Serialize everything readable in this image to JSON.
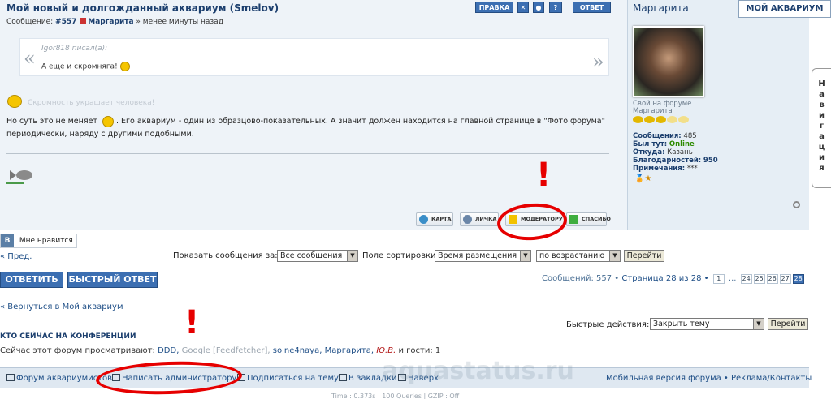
{
  "post": {
    "title": "Мой новый и долгожданный аквариум (Smelov)",
    "meta_prefix": "Сообщение:",
    "post_number": "#557",
    "author": "Маргарита",
    "meta_time": "» менее минуты назад",
    "buttons": {
      "edit": "ПРАВКА",
      "reply": "ОТВЕТ"
    },
    "quote": {
      "author": "Igor818 писал(а):",
      "text": "А еще и скромняга!"
    },
    "motto": "Скромность украшает человека!",
    "body_line1_a": "Но суть это не меняет",
    "body_line1_b": ". Его аквариум - один из образцово-показательных. А значит должен находится на главной странице в \"Фото форума\"",
    "body_line2": "периодически, наряду с другими подобными.",
    "actions": {
      "map": "КАРТА",
      "pm": "ЛИЧКА",
      "moderator": "МОДЕРАТОРУ",
      "thanks": "СПАСИБО"
    }
  },
  "profile": {
    "username": "Маргарита",
    "logo": "МОЙ АКВАРИУМ",
    "role_line1": "Свой на форуме",
    "role_line2": "Маргарита",
    "posts_label": "Сообщения:",
    "posts_value": "485",
    "was_label": "Был тут:",
    "was_value": "Online",
    "from_label": "Откуда:",
    "from_value": "Казань",
    "thanks_label": "Благодарностей:",
    "thanks_value": "950",
    "notes_label": "Примечания:",
    "notes_value": "***"
  },
  "nav_tab": {
    "letters": [
      "Н",
      "а",
      "в",
      "и",
      "г",
      "а",
      "ц",
      "и",
      "я"
    ]
  },
  "like": {
    "vk": "В",
    "label": "Мне нравится"
  },
  "filters": {
    "prev": "« Пред.",
    "show_label": "Показать сообщения за:",
    "show_value": "Все сообщения",
    "sort_label": "Поле сортировки",
    "sort_value": "Время размещения",
    "order_value": "по возрастанию",
    "go": "Перейти"
  },
  "buttons": {
    "reply": "ОТВЕТИТЬ",
    "quick_reply": "БЫСТРЫЙ ОТВЕТ"
  },
  "pagination": {
    "summary_prefix": "Сообщений: 557 •",
    "page_text": "Страница 28 из 28 •",
    "pages": [
      "1",
      "...",
      "24",
      "25",
      "26",
      "27",
      "28"
    ],
    "current": "28"
  },
  "back_link": "« Вернуться в Мой аквариум",
  "quick_actions": {
    "label": "Быстрые действия:",
    "value": "Закрыть тему",
    "go": "Перейти"
  },
  "online": {
    "heading": "КТО СЕЙЧАС НА КОНФЕРЕНЦИИ",
    "prefix": "Сейчас этот форум просматривают:",
    "users": [
      "DDD,",
      "Google [Feedfetcher],",
      "solne4naya,",
      "Маргарита,"
    ],
    "special_user": "Ю.В.",
    "guests": "и гости: 1"
  },
  "footer": {
    "forum": "Форум аквариумистов",
    "write_admin": "Написать администратору",
    "subscribe": "Подписаться на тему",
    "bookmarks": "В закладки",
    "top": "Наверх",
    "right": "Мобильная версия форума • Реклама/Контакты",
    "stats": "Time : 0.373s | 100 Queries | GZIP : Off",
    "watermark": "aquastatus.ru"
  },
  "colors": {
    "accent": "#3c6fb2",
    "annotation": "#e60000",
    "online": "#2e8b00"
  }
}
